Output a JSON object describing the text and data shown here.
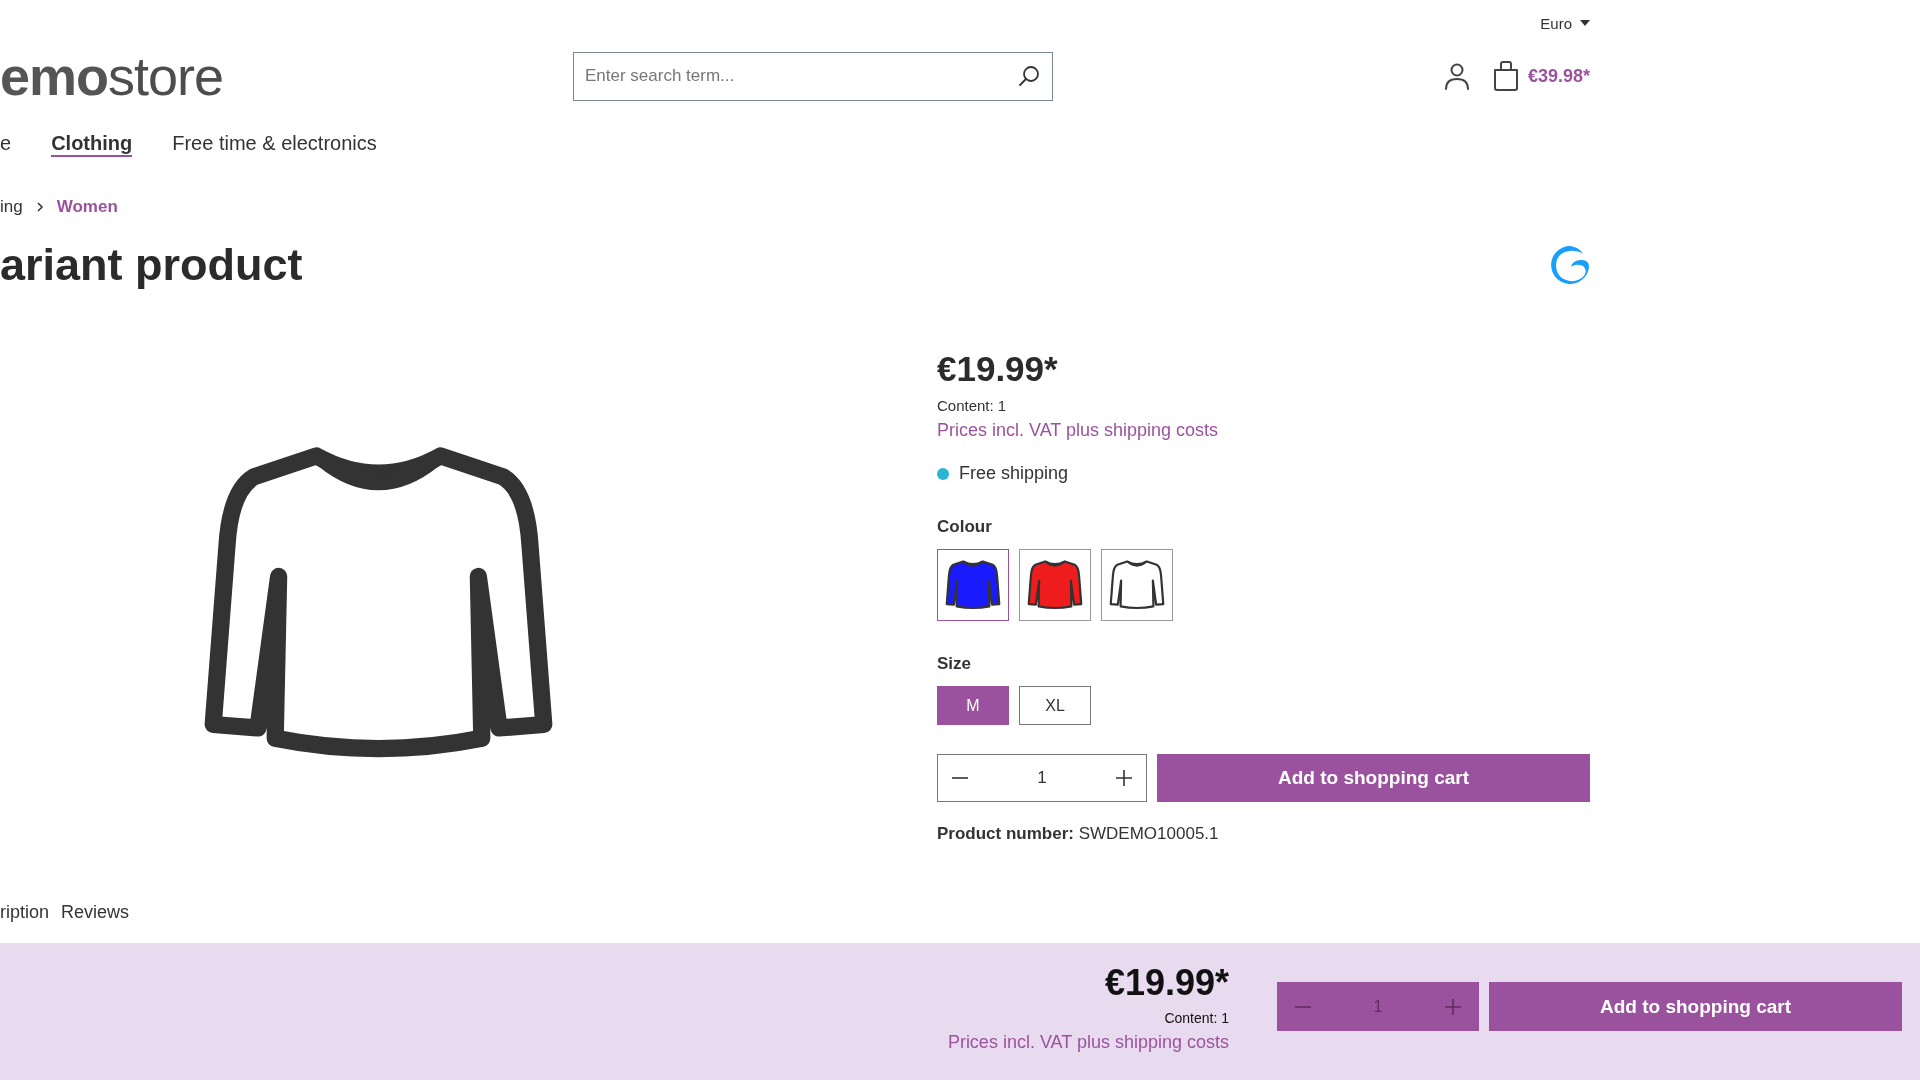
{
  "currency": {
    "label": "Euro"
  },
  "logo": {
    "bold": "emo",
    "light": "store"
  },
  "search": {
    "placeholder": "Enter search term..."
  },
  "cart": {
    "total": "€39.98*"
  },
  "nav": [
    {
      "label": "e",
      "selected": false
    },
    {
      "label": "Clothing",
      "selected": true
    },
    {
      "label": "Free time & electronics",
      "selected": false
    }
  ],
  "breadcrumb": [
    {
      "label": "ing",
      "current": false
    },
    {
      "label": "Women",
      "current": true
    }
  ],
  "title": "ariant product",
  "product": {
    "price": "€19.99*",
    "content": "Content: 1",
    "tax_link": "Prices incl. VAT plus shipping costs",
    "delivery": {
      "text": "Free shipping",
      "color": "#2bb5d0"
    },
    "colour_label": "Colour",
    "colours": [
      {
        "color": "#1a1aff",
        "selected": true
      },
      {
        "color": "#ee1c1c",
        "selected": false
      },
      {
        "color": "#ffffff",
        "selected": false
      }
    ],
    "size_label": "Size",
    "sizes": [
      {
        "label": "M",
        "selected": true
      },
      {
        "label": "XL",
        "selected": false
      }
    ],
    "quantity": "1",
    "add_button": "Add to shopping cart",
    "product_number": "**Product number:** SWDEMO10005.1"
  },
  "tabs": [
    {
      "label": "ription"
    },
    {
      "label": "Reviews"
    }
  ],
  "sticky_bar": {
    "price": "€19.99*",
    "content": "Content: 1",
    "tax_link": "Prices incl. VAT plus shipping costs",
    "quantity": "1",
    "add_button": "Add to shopping cart"
  }
}
